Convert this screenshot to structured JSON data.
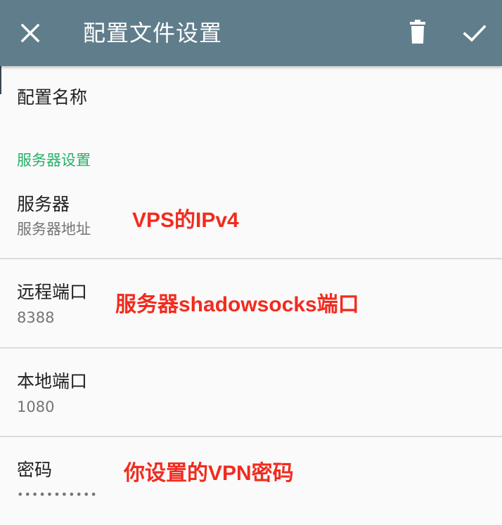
{
  "toolbar": {
    "title": "配置文件设置",
    "close_icon": "close-icon",
    "delete_icon": "delete-icon",
    "done_icon": "check-icon",
    "background": "#607d8b"
  },
  "profile_name": {
    "title": "配置名称"
  },
  "server_category": {
    "label": "服务器设置",
    "color": "#26b06b"
  },
  "server": {
    "title": "服务器",
    "summary": "服务器地址"
  },
  "remote_port": {
    "title": "远程端口",
    "summary": "8388"
  },
  "local_port": {
    "title": "本地端口",
    "summary": "1080"
  },
  "password": {
    "title": "密码",
    "summary": "•••••••••••"
  },
  "annotations": {
    "server": "VPS的IPv4",
    "remote_port": "服务器shadowsocks端口",
    "password": "你设置的VPN密码",
    "color": "#f22b1e"
  }
}
